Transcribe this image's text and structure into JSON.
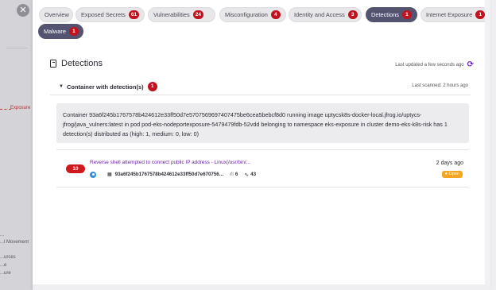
{
  "background": {
    "exposure_label": "Exposure",
    "sidebar_items": [
      "...",
      "...l Movement",
      "...urces",
      "...e",
      "...ure"
    ]
  },
  "tabs": [
    {
      "label": "Overview",
      "badge": null,
      "active": false
    },
    {
      "label": "Exposed Secrets",
      "badge": "61",
      "active": false
    },
    {
      "label": "Vulnerabilities",
      "badge": "24",
      "active": false
    },
    {
      "label": "Misconfiguration",
      "badge": "4",
      "active": false
    },
    {
      "label": "Identity and Access",
      "badge": "3",
      "active": false
    },
    {
      "label": "Detections",
      "badge": "1",
      "active": true
    },
    {
      "label": "Internet Exposure",
      "badge": "1",
      "active": false
    },
    {
      "label": "Malware",
      "badge": "1",
      "active": false
    }
  ],
  "section": {
    "title": "Detections",
    "last_updated": "Last updated a few seconds ago"
  },
  "container": {
    "header_label": "Container with detection(s)",
    "badge": "1",
    "last_scanned": "Last scanned: 2 hours ago",
    "info_text": "Container 93a6f245b1767578b424612e33ff50d7e5707569697407475be6cea5bebcf8d0 running image uptycsk8s-docker-local.jfrog.io/uptycs-jfrog/java_vulners:latest in pod pod-eks-nodeportexposure-5479479fdb-52vdd belonging to namespace eks-exposure in cluster demo-eks-k8s-risk has 1 detection(s) distributed as (high: 1, medium: 0, low: 0)"
  },
  "detection": {
    "score": "10",
    "title": "Reverse shell attempted to connect public IP address - Linux(/usr/bin/...",
    "hash": "93a6f245b1767578b424612e33ff50d7e670756...",
    "count_a": "6",
    "count_b": "43",
    "time_ago": "2 days ago",
    "status": "Open"
  },
  "colors": {
    "badge_red": "#c1121f",
    "active_tab": "#545470",
    "link_purple": "#6b21a8",
    "status_open": "#f4a623"
  }
}
